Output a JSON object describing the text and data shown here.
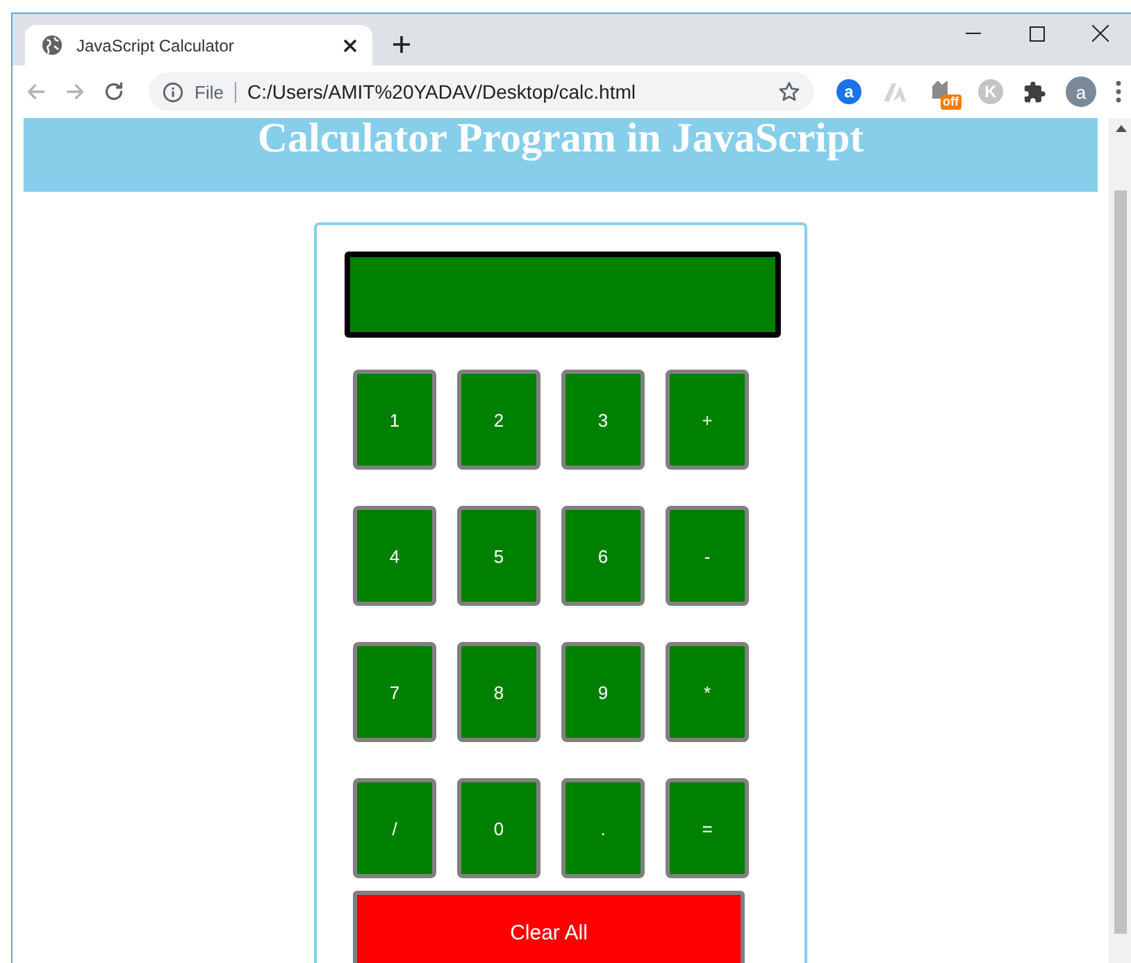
{
  "browser": {
    "tab_title": "JavaScript Calculator",
    "scheme": "File",
    "url": "C:/Users/AMIT%20YADAV/Desktop/calc.html",
    "profile_initial": "a",
    "nav": [
      {
        "kind": "back",
        "disabled": true
      },
      {
        "kind": "forward",
        "disabled": true
      },
      {
        "kind": "reload",
        "disabled": false
      }
    ],
    "extensions": [
      {
        "kind": "letter",
        "label": "a",
        "color": "#1a73e8"
      },
      {
        "kind": "mark"
      },
      {
        "kind": "badge",
        "label": "off"
      },
      {
        "kind": "letter",
        "label": "K",
        "color": "#c4c4c4"
      },
      {
        "kind": "puzzle"
      }
    ]
  },
  "page": {
    "heading": "Calculator Program in JavaScript",
    "keys": [
      {
        "label": "1"
      },
      {
        "label": "2"
      },
      {
        "label": "3"
      },
      {
        "label": "+"
      },
      {
        "label": "4"
      },
      {
        "label": "5"
      },
      {
        "label": "6"
      },
      {
        "label": "-"
      },
      {
        "label": "7"
      },
      {
        "label": "8"
      },
      {
        "label": "9"
      },
      {
        "label": "*"
      },
      {
        "label": "/"
      },
      {
        "label": "0"
      },
      {
        "label": "."
      },
      {
        "label": "="
      }
    ],
    "clear_button": "Clear All"
  }
}
